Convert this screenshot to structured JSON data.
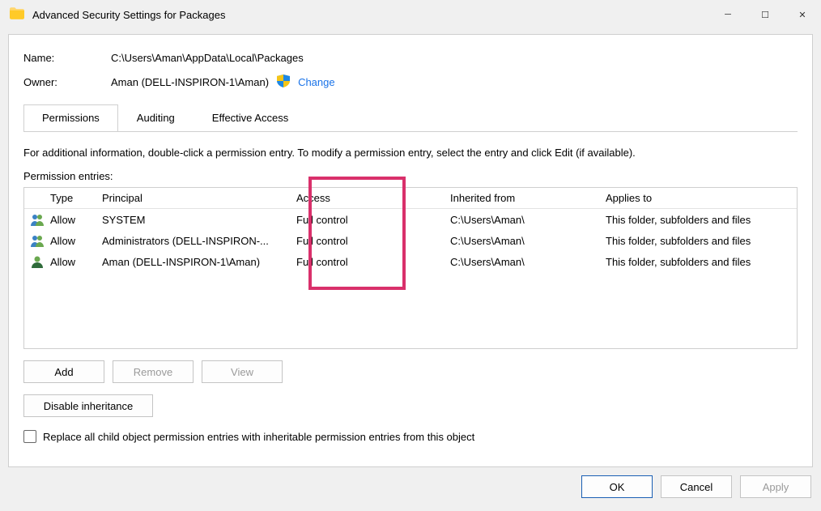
{
  "title": "Advanced Security Settings for Packages",
  "name_label": "Name:",
  "name_value": "C:\\Users\\Aman\\AppData\\Local\\Packages",
  "owner_label": "Owner:",
  "owner_value": "Aman (DELL-INSPIRON-1\\Aman)",
  "change_link": "Change",
  "tabs": {
    "permissions": "Permissions",
    "auditing": "Auditing",
    "effective": "Effective Access"
  },
  "info_text": "For additional information, double-click a permission entry. To modify a permission entry, select the entry and click Edit (if available).",
  "entries_label": "Permission entries:",
  "columns": {
    "type": "Type",
    "principal": "Principal",
    "access": "Access",
    "inherited": "Inherited from",
    "applies": "Applies to"
  },
  "rows": [
    {
      "icon": "group",
      "type": "Allow",
      "principal": "SYSTEM",
      "access": "Full control",
      "inherited": "C:\\Users\\Aman\\",
      "applies": "This folder, subfolders and files"
    },
    {
      "icon": "group",
      "type": "Allow",
      "principal": "Administrators (DELL-INSPIRON-...",
      "access": "Full control",
      "inherited": "C:\\Users\\Aman\\",
      "applies": "This folder, subfolders and files"
    },
    {
      "icon": "user",
      "type": "Allow",
      "principal": "Aman (DELL-INSPIRON-1\\Aman)",
      "access": "Full control",
      "inherited": "C:\\Users\\Aman\\",
      "applies": "This folder, subfolders and files"
    }
  ],
  "buttons": {
    "add": "Add",
    "remove": "Remove",
    "view": "View",
    "disable_inheritance": "Disable inheritance"
  },
  "replace_checkbox_label": "Replace all child object permission entries with inheritable permission entries from this object",
  "footer": {
    "ok": "OK",
    "cancel": "Cancel",
    "apply": "Apply"
  }
}
